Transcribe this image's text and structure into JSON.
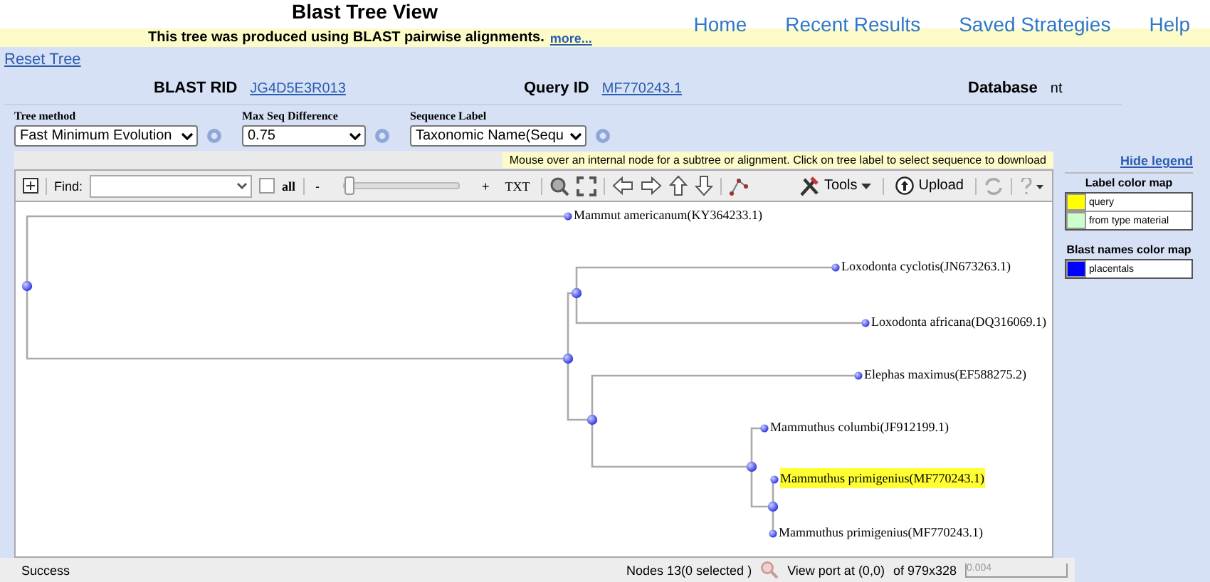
{
  "header": {
    "title": "Blast Tree View",
    "nav": [
      "Home",
      "Recent Results",
      "Saved Strategies",
      "Help"
    ]
  },
  "banner": {
    "text": "This tree was produced using BLAST pairwise alignments.",
    "link": "more..."
  },
  "reset_link": "Reset Tree",
  "info": [
    {
      "label": "BLAST RID",
      "value": "JG4D5E3R013",
      "kind": "link"
    },
    {
      "label": "Query ID",
      "value": "MF770243.1",
      "kind": "link"
    },
    {
      "label": "Database",
      "value": "nt",
      "kind": "text"
    }
  ],
  "options": [
    {
      "label": "Tree method",
      "value": "Fast Minimum Evolution"
    },
    {
      "label": "Max Seq Difference",
      "value": "0.75"
    },
    {
      "label": "Sequence Label",
      "value": "Taxonomic Name(Sequ"
    }
  ],
  "hint": "Mouse over an internal node for a subtree or alignment. Click on tree label to select sequence to download",
  "toolbar": {
    "find_label": "Find:",
    "all_label": "all",
    "all_checked": false,
    "zoom_minus": "-",
    "zoom_plus": "+",
    "zoom": {
      "level": 0
    },
    "txt": "TXT",
    "tools": "Tools",
    "upload": "Upload"
  },
  "tree": {
    "children": [
      {
        "label": "Mammut americanum(KY364233.1)",
        "highlighted": false
      },
      {
        "children": [
          {
            "children": [
              {
                "label": "Loxodonta cyclotis(JN673263.1)",
                "highlighted": false
              },
              {
                "label": "Loxodonta africana(DQ316069.1)",
                "highlighted": false
              }
            ]
          },
          {
            "children": [
              {
                "label": "Elephas maximus(EF588275.2)",
                "highlighted": false
              },
              {
                "children": [
                  {
                    "label": "Mammuthus columbi(JF912199.1)",
                    "highlighted": false
                  },
                  {
                    "children": [
                      {
                        "label": "Mammuthus primigenius(MF770243.1)",
                        "highlighted": true
                      },
                      {
                        "label": "Mammuthus primigenius(MF770243.1)",
                        "highlighted": false
                      }
                    ]
                  }
                ]
              }
            ]
          }
        ]
      }
    ]
  },
  "legend": {
    "hide_link": "Hide legend",
    "label_map_title": "Label color map",
    "label_map": [
      {
        "name": "query",
        "color": "#ffff00"
      },
      {
        "name": "from type material",
        "color": "#ccffcc"
      }
    ],
    "blast_map_title": "Blast names color map",
    "blast_map": [
      {
        "name": "placentals",
        "color": "#0000ff"
      }
    ]
  },
  "status": {
    "text": "Success",
    "nodes": "Nodes 13(0 selected )",
    "viewport": "View port at (0,0)",
    "size": "of 979x328",
    "scale": "0.004"
  }
}
